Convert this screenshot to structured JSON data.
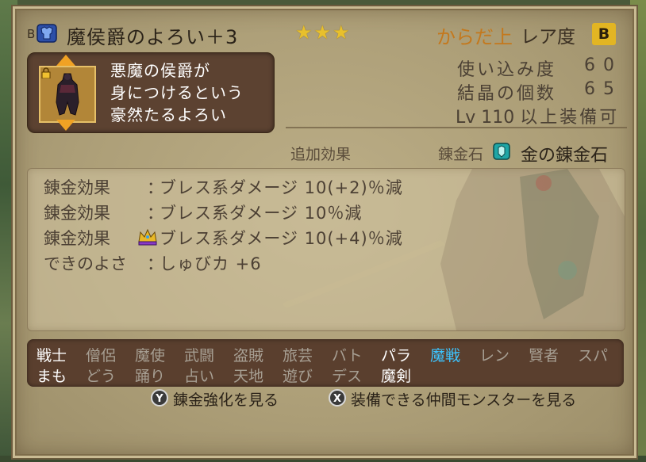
{
  "title": {
    "prefix": "B",
    "item_name": "魔侯爵のよろい＋3",
    "stars": "★★★",
    "slot": "からだ上",
    "rarity_label": "レア度",
    "rarity": "B"
  },
  "description": [
    "悪魔の侯爵が",
    "身につけるという",
    "豪然たるよろい"
  ],
  "stats": {
    "wear_label": "使い込み度",
    "wear_value": "60",
    "crystal_label": "結晶の個数",
    "crystal_value": "65",
    "lv_prefix": "Lv",
    "lv_value": "110",
    "lv_suffix": "以上装備可"
  },
  "alchemy": {
    "extra_effects_label": "追加効果",
    "stone_label": "錬金石",
    "stone_name": "金の錬金石"
  },
  "effects": [
    {
      "label": "錬金効果",
      "colon": "：",
      "value": "ブレス系ダメージ 10(+2)％減"
    },
    {
      "label": "錬金効果",
      "colon": "：",
      "value": "ブレス系ダメージ 10％減"
    },
    {
      "label": "錬金効果",
      "colon": "",
      "value": "ブレス系ダメージ 10(+4)％減"
    },
    {
      "label": "できのよさ",
      "colon": "：",
      "value": "しゅびカ +6"
    }
  ],
  "jobs_row1": [
    "戦士",
    "僧侶",
    "魔使",
    "武闘",
    "盗賊",
    "旅芸",
    "バト",
    "パラ",
    "魔戦",
    "レン",
    "賢者",
    "スパ"
  ],
  "jobs_row2": [
    "まも",
    "どう",
    "踊り",
    "占い",
    "天地",
    "遊び",
    "デス",
    "魔剣"
  ],
  "footer": {
    "y_button": "Y",
    "y_label": "錬金強化を見る",
    "x_button": "X",
    "x_label": "装備できる仲間モンスターを見る"
  },
  "colors": {
    "parchment": "#b3a47e",
    "slot": "#c4781c",
    "stars": "#e8c02c",
    "rarity_badge": "#e2b523",
    "job_selected": "#3cc4ff"
  }
}
